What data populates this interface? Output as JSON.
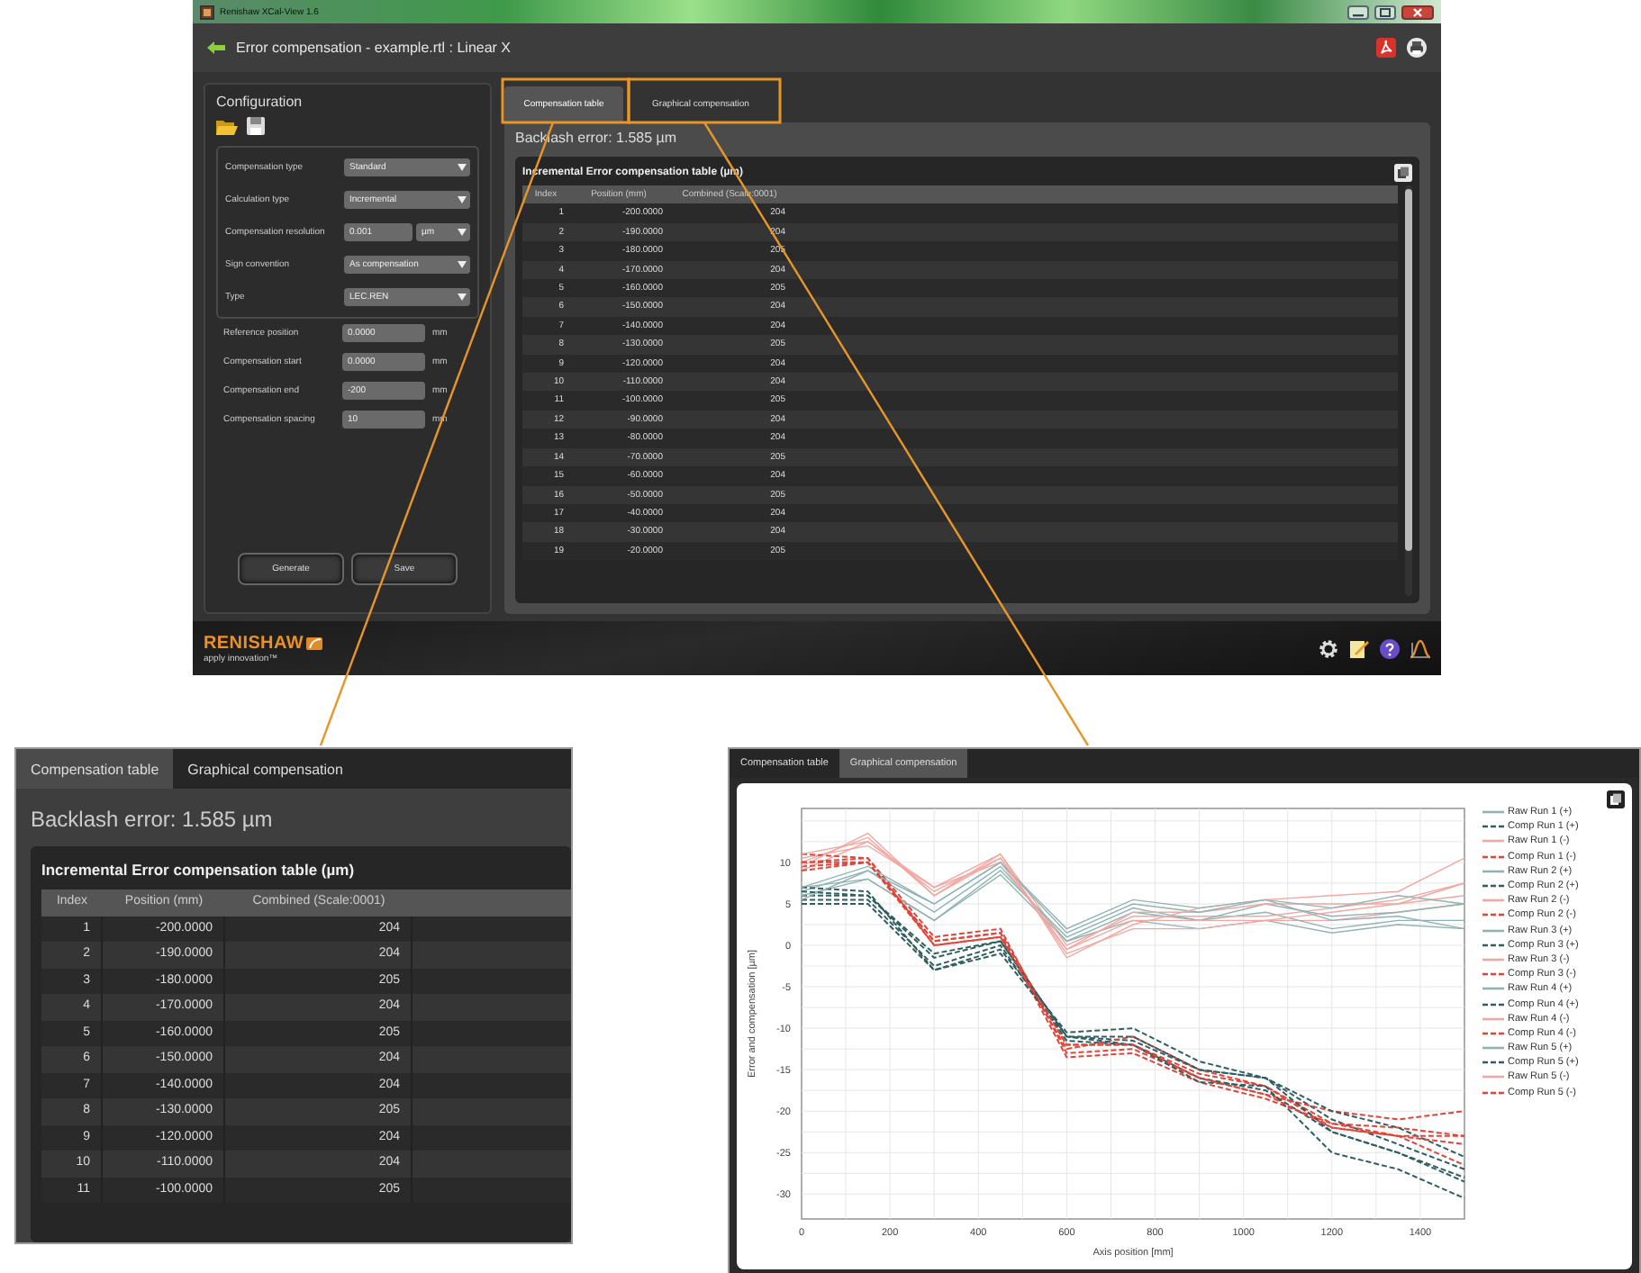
{
  "window": {
    "title": "Renishaw XCal-View 1.6"
  },
  "header": {
    "title": "Error compensation - example.rtl : Linear X"
  },
  "configuration": {
    "title": "Configuration",
    "settings": [
      {
        "kind": "dropdown",
        "label": "Compensation type",
        "value": "Standard"
      },
      {
        "kind": "dropdown",
        "label": "Calculation type",
        "value": "Incremental"
      },
      {
        "kind": "number-unit",
        "label": "Compensation resolution",
        "value": "0.001",
        "unit": "µm"
      },
      {
        "kind": "dropdown",
        "label": "Sign convention",
        "value": "As compensation"
      },
      {
        "kind": "dropdown",
        "label": "Type",
        "value": "LEC.REN"
      }
    ],
    "fields": [
      {
        "label": "Reference position",
        "value": "0.0000",
        "unit": "mm"
      },
      {
        "label": "Compensation start",
        "value": "0.0000",
        "unit": "mm"
      },
      {
        "label": "Compensation end",
        "value": "-200",
        "unit": "mm"
      },
      {
        "label": "Compensation spacing",
        "value": "10",
        "unit": "mm"
      }
    ],
    "buttons": [
      "Generate",
      "Save"
    ]
  },
  "tabs": [
    {
      "label": "Compensation table",
      "selected": true
    },
    {
      "label": "Graphical compensation",
      "selected": false
    }
  ],
  "backlash": "Backlash error: 1.585 µm",
  "table": {
    "title": "Incremental Error compensation table (µm)",
    "columns": [
      "Index",
      "Position (mm)",
      "Combined (Scale:0001)"
    ],
    "rows": [
      [
        "1",
        "-200.0000",
        "204"
      ],
      [
        "2",
        "-190.0000",
        "204"
      ],
      [
        "3",
        "-180.0000",
        "205"
      ],
      [
        "4",
        "-170.0000",
        "204"
      ],
      [
        "5",
        "-160.0000",
        "205"
      ],
      [
        "6",
        "-150.0000",
        "204"
      ],
      [
        "7",
        "-140.0000",
        "204"
      ],
      [
        "8",
        "-130.0000",
        "205"
      ],
      [
        "9",
        "-120.0000",
        "204"
      ],
      [
        "10",
        "-110.0000",
        "204"
      ],
      [
        "11",
        "-100.0000",
        "205"
      ],
      [
        "12",
        "-90.0000",
        "204"
      ],
      [
        "13",
        "-80.0000",
        "204"
      ],
      [
        "14",
        "-70.0000",
        "205"
      ],
      [
        "15",
        "-60.0000",
        "204"
      ],
      [
        "16",
        "-50.0000",
        "205"
      ],
      [
        "17",
        "-40.0000",
        "204"
      ],
      [
        "18",
        "-30.0000",
        "204"
      ],
      [
        "19",
        "-20.0000",
        "205"
      ]
    ]
  },
  "footer": {
    "logo": "RENISHAW",
    "tagline": "apply innovation™"
  },
  "table_callout": {
    "tabs": [
      {
        "label": "Compensation table",
        "selected": true
      },
      {
        "label": "Graphical compensation",
        "selected": false
      }
    ],
    "backlash": "Backlash error: 1.585 µm",
    "table": {
      "title": "Incremental Error compensation table (µm)",
      "columns": [
        "Index",
        "Position (mm)",
        "Combined (Scale:0001)"
      ],
      "rows": [
        [
          "1",
          "-200.0000",
          "204"
        ],
        [
          "2",
          "-190.0000",
          "204"
        ],
        [
          "3",
          "-180.0000",
          "205"
        ],
        [
          "4",
          "-170.0000",
          "204"
        ],
        [
          "5",
          "-160.0000",
          "205"
        ],
        [
          "6",
          "-150.0000",
          "204"
        ],
        [
          "7",
          "-140.0000",
          "204"
        ],
        [
          "8",
          "-130.0000",
          "205"
        ],
        [
          "9",
          "-120.0000",
          "204"
        ],
        [
          "10",
          "-110.0000",
          "204"
        ],
        [
          "11",
          "-100.0000",
          "205"
        ]
      ]
    }
  },
  "chart_callout": {
    "tabs": [
      {
        "label": "Compensation table",
        "selected": false
      },
      {
        "label": "Graphical compensation",
        "selected": true
      }
    ],
    "chart_data": {
      "type": "line",
      "xlabel": "Axis position [mm]",
      "ylabel": "Error and compensation [µm]",
      "x": [
        0,
        150,
        300,
        450,
        600,
        750,
        900,
        1050,
        1200,
        1350,
        1500
      ],
      "xlim": [
        0,
        1500
      ],
      "ylim": [
        -33,
        16.5
      ],
      "xticks": [
        0,
        200,
        400,
        600,
        800,
        1000,
        1200,
        1400
      ],
      "yticks": [
        -30,
        -25,
        -20,
        -15,
        -10,
        -5,
        0,
        5,
        10
      ],
      "grid": true,
      "legend": true,
      "series": [
        {
          "name": "Raw Run 1 (+)",
          "line_style": "solid",
          "color": "#8fb3b3",
          "values": [
            7,
            8,
            3,
            8.5,
            0.5,
            3,
            2,
            3,
            1.5,
            2.5,
            2
          ]
        },
        {
          "name": "Comp Run 1 (+)",
          "line_style": "dashed",
          "color": "#2f5f63",
          "values": [
            6,
            6,
            -1.5,
            0.5,
            -11,
            -11.5,
            -15,
            -16,
            -21,
            -24,
            -27
          ]
        },
        {
          "name": "Raw Run 1 (-)",
          "line_style": "solid",
          "color": "#f2a7a2",
          "values": [
            9,
            12.5,
            6.5,
            10.5,
            -1,
            2,
            2,
            3,
            3,
            4,
            5
          ]
        },
        {
          "name": "Comp Run 1 (-)",
          "line_style": "dashed",
          "color": "#e0453a",
          "values": [
            9,
            10,
            0.5,
            1.5,
            -12,
            -12,
            -15.5,
            -17,
            -21.5,
            -22,
            -23
          ]
        },
        {
          "name": "Raw Run 2 (+)",
          "line_style": "solid",
          "color": "#8fb3b3",
          "values": [
            6.5,
            9,
            4,
            9.5,
            0.5,
            4,
            3,
            4,
            2,
            3,
            3
          ]
        },
        {
          "name": "Comp Run 2 (+)",
          "line_style": "dashed",
          "color": "#2f5f63",
          "values": [
            5.5,
            5.5,
            -2.5,
            0,
            -11.5,
            -12,
            -16,
            -17.5,
            -22.5,
            -25,
            -28.5
          ]
        },
        {
          "name": "Raw Run 2 (-)",
          "line_style": "solid",
          "color": "#f2a7a2",
          "values": [
            10,
            13,
            6,
            11,
            0,
            3.5,
            3.5,
            3.5,
            4.5,
            5.5,
            7.5
          ]
        },
        {
          "name": "Comp Run 2 (-)",
          "line_style": "dashed",
          "color": "#e0453a",
          "values": [
            10,
            10.5,
            1,
            2,
            -13,
            -12.5,
            -16,
            -18,
            -20,
            -21,
            -20
          ]
        },
        {
          "name": "Raw Run 3 (+)",
          "line_style": "solid",
          "color": "#8fb3b3",
          "values": [
            6,
            8,
            3,
            9,
            1,
            4.5,
            3,
            5,
            3.5,
            4,
            5
          ]
        },
        {
          "name": "Comp Run 3 (+)",
          "line_style": "dashed",
          "color": "#2f5f63",
          "values": [
            7,
            6.5,
            -3,
            -0.5,
            -10.5,
            -10,
            -14,
            -16,
            -20,
            -22,
            -25.5
          ]
        },
        {
          "name": "Raw Run 3 (-)",
          "line_style": "solid",
          "color": "#f2a7a2",
          "values": [
            10.5,
            12,
            7,
            10,
            -0.5,
            4,
            4,
            5,
            5,
            5,
            6
          ]
        },
        {
          "name": "Comp Run 3 (-)",
          "line_style": "dashed",
          "color": "#e0453a",
          "values": [
            11,
            10.5,
            0,
            1,
            -12.5,
            -11,
            -15,
            -17,
            -22,
            -23,
            -24
          ]
        },
        {
          "name": "Raw Run 4 (+)",
          "line_style": "solid",
          "color": "#8fb3b3",
          "values": [
            5.5,
            9,
            5,
            10,
            1.5,
            5,
            4,
            5.5,
            4.5,
            6,
            5
          ]
        },
        {
          "name": "Comp Run 4 (+)",
          "line_style": "dashed",
          "color": "#2f5f63",
          "values": [
            6.5,
            6,
            -1,
            0.5,
            -11,
            -11,
            -15,
            -16,
            -22.5,
            -25,
            -28
          ]
        },
        {
          "name": "Raw Run 4 (-)",
          "line_style": "solid",
          "color": "#f2a7a2",
          "values": [
            11,
            12.5,
            7,
            11,
            -1.5,
            2.5,
            4.5,
            5.5,
            6,
            6.5,
            10.5
          ]
        },
        {
          "name": "Comp Run 4 (-)",
          "line_style": "dashed",
          "color": "#e0453a",
          "values": [
            9.5,
            10,
            0.5,
            1.5,
            -13.5,
            -13,
            -16.5,
            -18.5,
            -21.5,
            -23,
            -26.5
          ]
        },
        {
          "name": "Raw Run 5 (+)",
          "line_style": "solid",
          "color": "#8fb3b3",
          "values": [
            7,
            9.5,
            5,
            10,
            2,
            5.5,
            4.5,
            5.5,
            3,
            3.5,
            2
          ]
        },
        {
          "name": "Comp Run 5 (+)",
          "line_style": "dashed",
          "color": "#2f5f63",
          "values": [
            5,
            5,
            -3,
            -1,
            -11,
            -12,
            -16.5,
            -17,
            -25,
            -27,
            -30.5
          ]
        },
        {
          "name": "Raw Run 5 (-)",
          "line_style": "solid",
          "color": "#f2a7a2",
          "values": [
            9.5,
            13.5,
            6,
            10.5,
            -0.5,
            3,
            3,
            3,
            4,
            5,
            7.5
          ]
        },
        {
          "name": "Comp Run 5 (-)",
          "line_style": "dashed",
          "color": "#e0453a",
          "values": [
            10,
            10,
            0,
            1,
            -12,
            -12,
            -16,
            -18,
            -22,
            -23,
            -23
          ]
        }
      ]
    }
  }
}
